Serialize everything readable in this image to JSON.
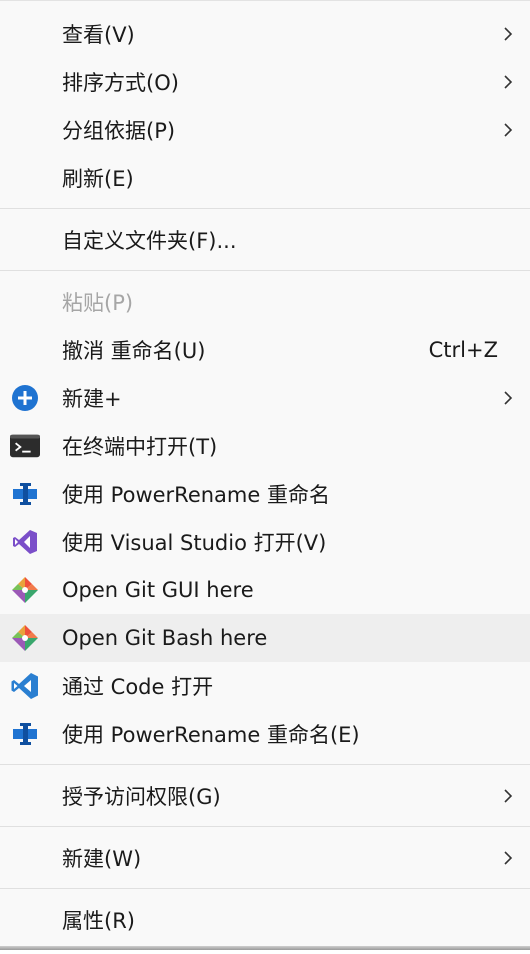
{
  "menu": {
    "items": [
      {
        "label": "查看(V)"
      },
      {
        "label": "排序方式(O)"
      },
      {
        "label": "分组依据(P)"
      },
      {
        "label": "刷新(E)"
      },
      {
        "label": "自定义文件夹(F)..."
      },
      {
        "label": "粘贴(P)"
      },
      {
        "label": "撤消 重命名(U)",
        "shortcut": "Ctrl+Z"
      },
      {
        "label": "新建+"
      },
      {
        "label": "在终端中打开(T)"
      },
      {
        "label": "使用 PowerRename 重命名"
      },
      {
        "label": "使用 Visual Studio 打开(V)"
      },
      {
        "label": "Open Git GUI here"
      },
      {
        "label": "Open Git Bash here"
      },
      {
        "label": "通过 Code 打开"
      },
      {
        "label": "使用 PowerRename 重命名(E)"
      },
      {
        "label": "授予访问权限(G)"
      },
      {
        "label": "新建(W)"
      },
      {
        "label": "属性(R)"
      }
    ]
  },
  "icons": {
    "new_plus": "plus-circle-icon",
    "terminal": "terminal-icon",
    "powerrename": "powerrename-icon",
    "visual_studio": "visual-studio-icon",
    "git_gui": "git-icon",
    "git_bash": "git-icon",
    "vscode": "vscode-icon",
    "powerrename_2": "powerrename-icon",
    "submenu": "chevron-right-icon"
  },
  "colors": {
    "menu_bg": "#f9f9f9",
    "hover_bg": "#eeeeee",
    "disabled_text": "#a6a6a6",
    "accent_blue": "#1f73d1",
    "vs_purple": "#7b4fc9",
    "vscode_blue": "#2a7fd1"
  }
}
